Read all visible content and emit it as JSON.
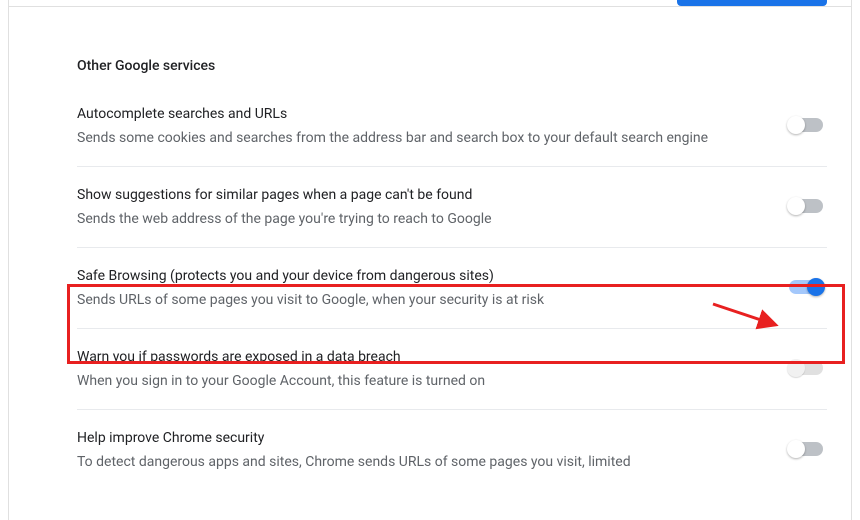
{
  "section": {
    "title": "Other Google services"
  },
  "settings": [
    {
      "title": "Autocomplete searches and URLs",
      "desc": "Sends some cookies and searches from the address bar and search box to your default search engine",
      "state": "off"
    },
    {
      "title": "Show suggestions for similar pages when a page can't be found",
      "desc": "Sends the web address of the page you're trying to reach to Google",
      "state": "off"
    },
    {
      "title": "Safe Browsing (protects you and your device from dangerous sites)",
      "desc": "Sends URLs of some pages you visit to Google, when your security is at risk",
      "state": "on"
    },
    {
      "title": "Warn you if passwords are exposed in a data breach",
      "desc": "When you sign in to your Google Account, this feature is turned on",
      "state": "disabled"
    },
    {
      "title": "Help improve Chrome security",
      "desc": "To detect dangerous apps and sites, Chrome sends URLs of some pages you visit, limited",
      "state": "off"
    }
  ],
  "annotation": {
    "arrow_color": "#e82020",
    "highlight_color": "#e82020"
  }
}
